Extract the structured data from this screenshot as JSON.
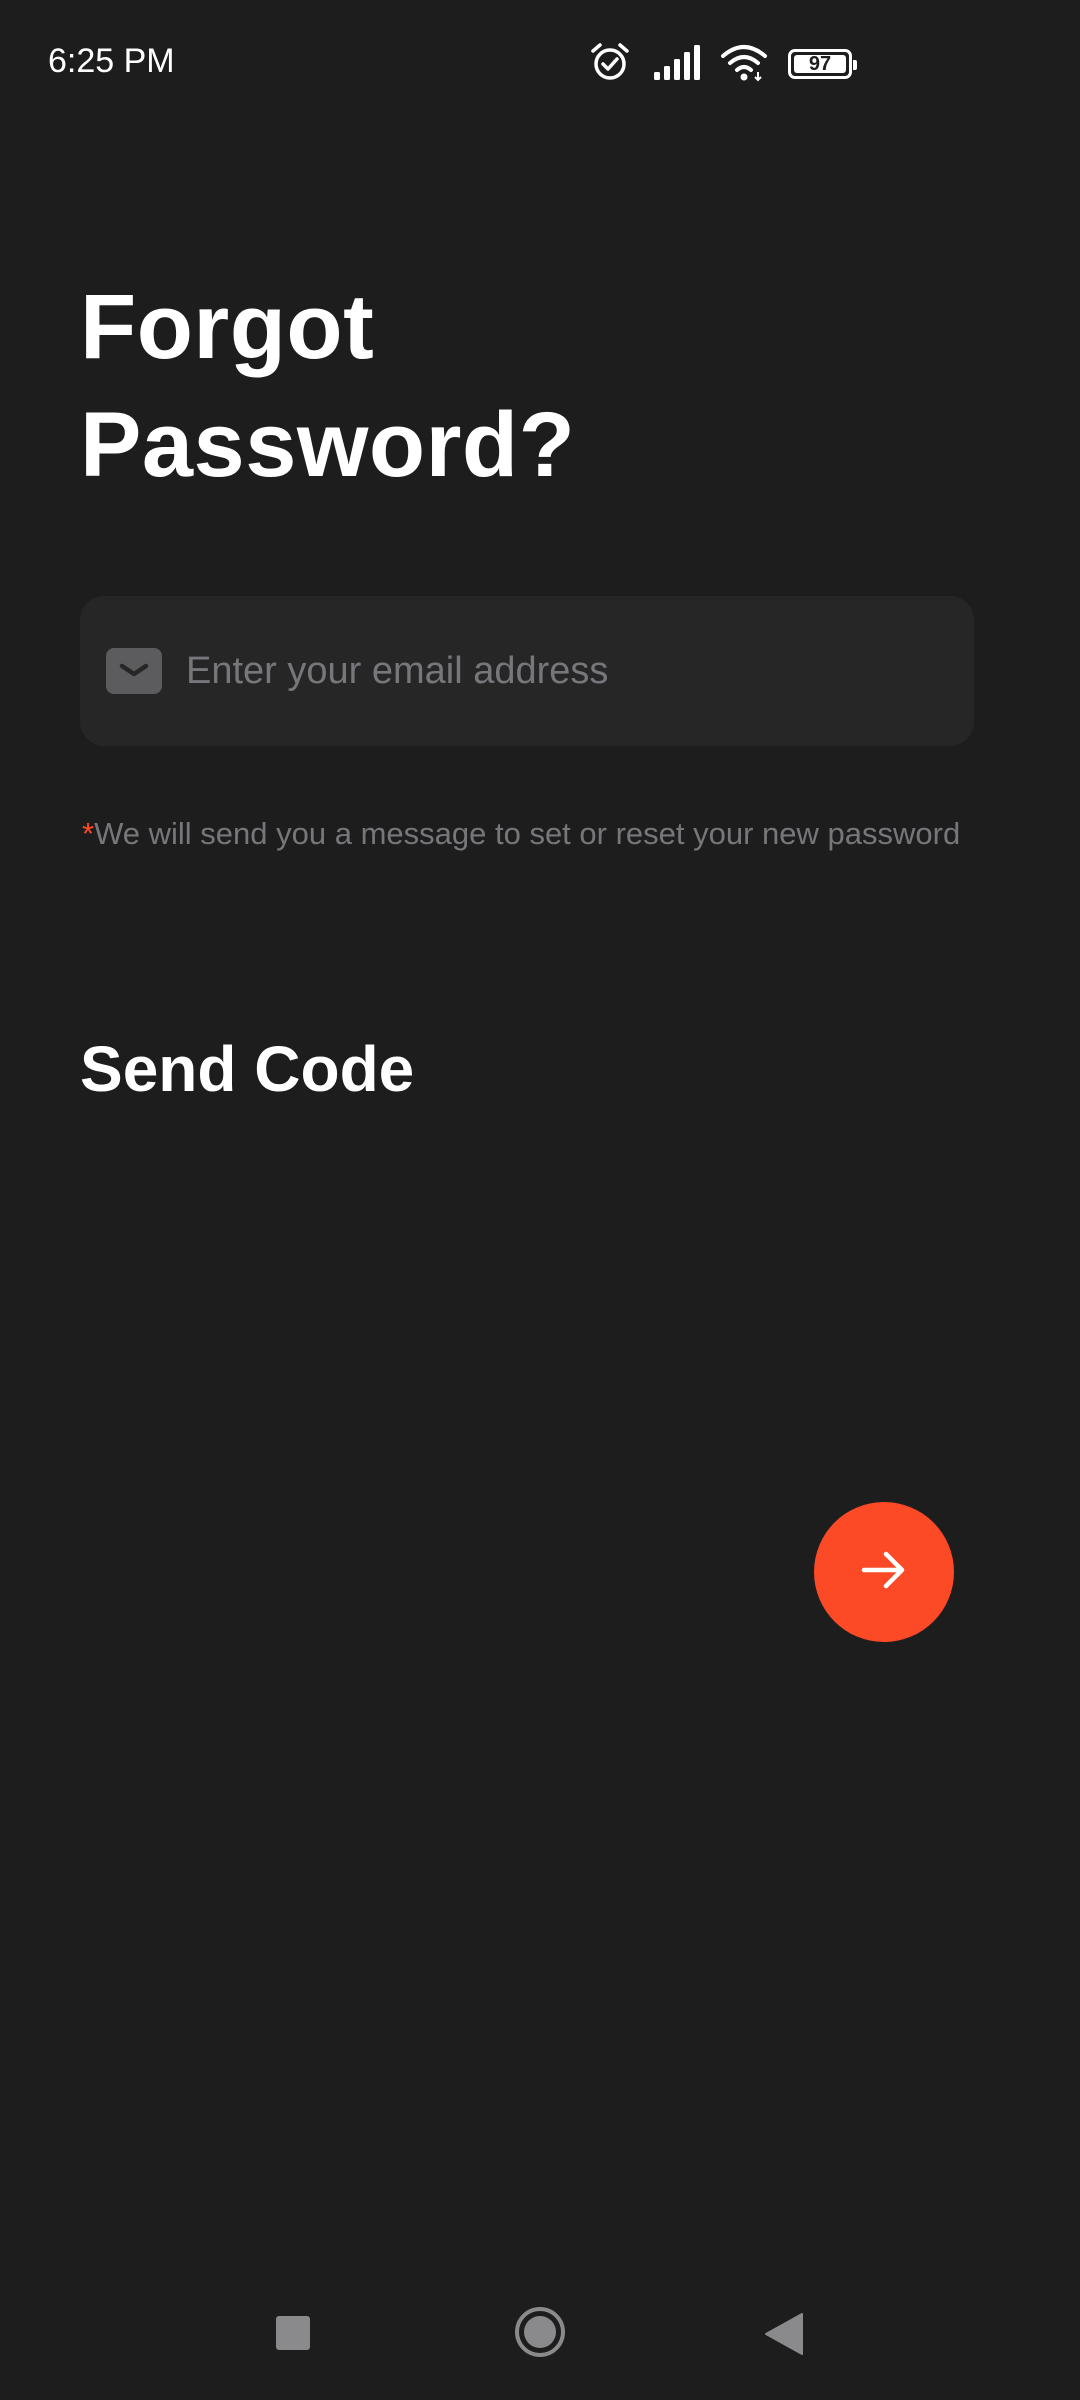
{
  "status_bar": {
    "time": "6:25 PM",
    "battery_level": "97",
    "icons": [
      "alarm-icon",
      "cellular-signal-icon",
      "wifi-icon",
      "battery-icon"
    ]
  },
  "title": {
    "line1": "Forgot",
    "line2": "Password?"
  },
  "email_field": {
    "icon": "mail-icon",
    "placeholder": "Enter your email address",
    "value": ""
  },
  "helper": {
    "required_marker": "*",
    "text": "We will send you a message to set or reset your new password"
  },
  "send_code": {
    "label": "Send Code",
    "button_icon": "arrow-right-icon"
  },
  "nav_bar": {
    "buttons": [
      "recents-button",
      "home-button",
      "back-button"
    ]
  },
  "colors": {
    "background": "#1e1d1e",
    "field_background": "#272627",
    "accent": "#fd4a26",
    "muted_text": "#77767a"
  }
}
